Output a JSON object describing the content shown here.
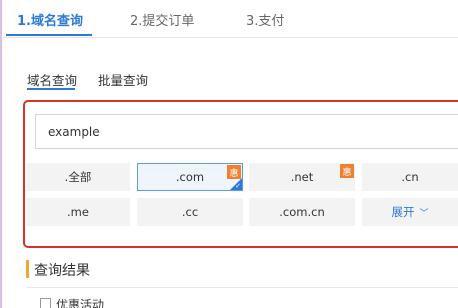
{
  "steps": [
    {
      "label": "1.域名查询"
    },
    {
      "label": "2.提交订单"
    },
    {
      "label": "3.支付"
    }
  ],
  "subtabs": [
    {
      "label": "域名查询"
    },
    {
      "label": "批量查询"
    }
  ],
  "search": {
    "value": "example"
  },
  "tlds": {
    "all": ".全部",
    "com": ".com",
    "net": ".net",
    "cn": ".cn",
    "me": ".me",
    "cc": ".cc",
    "comcn": ".com.cn",
    "expand": "展开"
  },
  "badges": {
    "hui": "惠"
  },
  "results": {
    "title": "查询结果",
    "promo": "优惠活动"
  },
  "colors": {
    "accent": "#2d7ad6",
    "highlight_box": "#d6332c",
    "badge": "#f07f2e"
  }
}
